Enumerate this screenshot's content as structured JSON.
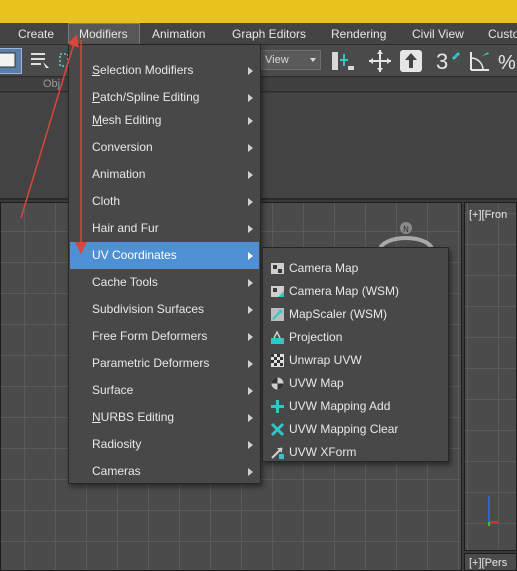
{
  "menubar": {
    "items": [
      {
        "label": "Create"
      },
      {
        "label": "Modifiers"
      },
      {
        "label": "Animation"
      },
      {
        "label": "Graph Editors"
      },
      {
        "label": "Rendering"
      },
      {
        "label": "Civil View"
      },
      {
        "label": "Custo"
      }
    ]
  },
  "toolbar": {
    "view_select": "View"
  },
  "ribbon": {
    "label": "Obj"
  },
  "viewports": {
    "right_top_label": "[+][Fron",
    "right_bottom_label": "[+][Pers"
  },
  "modifiers_menu": {
    "items": [
      {
        "label": "Selection Modifiers",
        "underline": "S",
        "rest": "election Modifiers"
      },
      {
        "label": "Patch/Spline Editing",
        "underline": "P",
        "rest": "atch/Spline Editing"
      },
      {
        "label": "Mesh Editing",
        "underline": "M",
        "rest": "esh Editing"
      },
      {
        "label": "Conversion",
        "underline": "",
        "rest": "Conversion"
      },
      {
        "label": "Animation",
        "underline": "",
        "rest": "Animation"
      },
      {
        "label": "Cloth",
        "underline": "",
        "rest": "Cloth"
      },
      {
        "label": "Hair and Fur",
        "underline": "",
        "rest": "Hair and Fur"
      },
      {
        "label": "UV Coordinates",
        "underline": "",
        "rest": "UV Coordinates"
      },
      {
        "label": "Cache Tools",
        "underline": "",
        "rest": "Cache Tools"
      },
      {
        "label": "Subdivision Surfaces",
        "underline": "",
        "rest": "Subdivision Surfaces"
      },
      {
        "label": "Free Form Deformers",
        "underline": "",
        "rest": "Free Form Deformers"
      },
      {
        "label": "Parametric Deformers",
        "underline": "",
        "rest": "Parametric Deformers"
      },
      {
        "label": "Surface",
        "underline": "",
        "rest": "Surface"
      },
      {
        "label": "NURBS Editing",
        "underline": "N",
        "rest": "URBS Editing"
      },
      {
        "label": "Radiosity",
        "underline": "",
        "rest": "Radiosity"
      },
      {
        "label": "Cameras",
        "underline": "",
        "rest": "Cameras"
      }
    ],
    "active_index": 7
  },
  "uv_submenu": {
    "items": [
      {
        "label": "Camera Map",
        "icon": "camera-map-icon"
      },
      {
        "label": "Camera Map (WSM)",
        "icon": "camera-map-wsm-icon"
      },
      {
        "label": "MapScaler (WSM)",
        "icon": "mapscaler-icon"
      },
      {
        "label": "Projection",
        "icon": "projection-icon"
      },
      {
        "label": "Unwrap UVW",
        "icon": "unwrap-uvw-icon"
      },
      {
        "label": "UVW Map",
        "icon": "uvw-map-icon"
      },
      {
        "label": "UVW Mapping Add",
        "icon": "uvw-mapping-add-icon"
      },
      {
        "label": "UVW Mapping Clear",
        "icon": "uvw-mapping-clear-icon"
      },
      {
        "label": "UVW XForm",
        "icon": "uvw-xform-icon"
      }
    ]
  },
  "colors": {
    "highlight": "#4f8fd4",
    "annotation_arrow": "#d9443b",
    "title_strip": "#e9c21c"
  }
}
